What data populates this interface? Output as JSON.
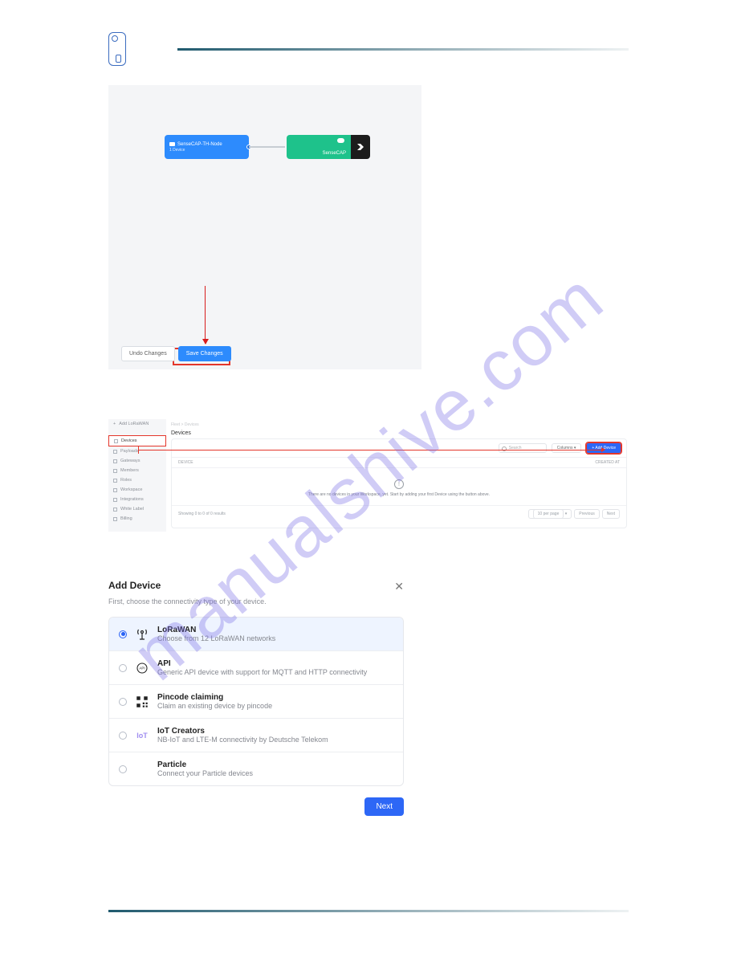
{
  "watermark": "manualshive.com",
  "figure1": {
    "node_title": "SenseCAP-TH-Node",
    "node_sub": "1 Device",
    "node2_label": "SenseCAP",
    "undo": "Undo Changes",
    "save": "Save Changes"
  },
  "figure2": {
    "sidebar_src_label": "Add LoRaWAN",
    "sidebar": [
      "Devices",
      "Payloads",
      "Gateways",
      "Members",
      "Roles",
      "Workspace",
      "Integrations",
      "White Label",
      "Billing"
    ],
    "crumb_root": "Fleet",
    "crumb_sep": ">",
    "crumb_leaf": "Devices",
    "title": "Devices",
    "search_ph": "Search",
    "columns": "Columns",
    "add_btn": "+ Add Device",
    "col_device": "DEVICE",
    "col_created": "CREATED AT",
    "empty_icon": "!",
    "empty_msg": "There are no devices in your Workspace, yet. Start by adding your first Device using the button above.",
    "showing": "Showing 0 to 0 of 0 results",
    "perpage": "10 per page",
    "prev": "Previous",
    "next": "Next"
  },
  "figure3": {
    "title": "Add Device",
    "subtitle": "First, choose the connectivity type of your device.",
    "options": [
      {
        "title": "LoRaWAN",
        "desc": "Choose from 12 LoRaWAN networks",
        "icon": "antenna",
        "selected": true
      },
      {
        "title": "API",
        "desc": "Generic API device with support for MQTT and HTTP connectivity",
        "icon": "api",
        "selected": false
      },
      {
        "title": "Pincode claiming",
        "desc": "Claim an existing device by pincode",
        "icon": "qr",
        "selected": false
      },
      {
        "title": "IoT Creators",
        "desc": "NB-IoT and LTE-M connectivity by Deutsche Telekom",
        "icon": "iot",
        "selected": false
      },
      {
        "title": "Particle",
        "desc": "Connect your Particle devices",
        "icon": "",
        "selected": false
      }
    ],
    "next": "Next"
  }
}
